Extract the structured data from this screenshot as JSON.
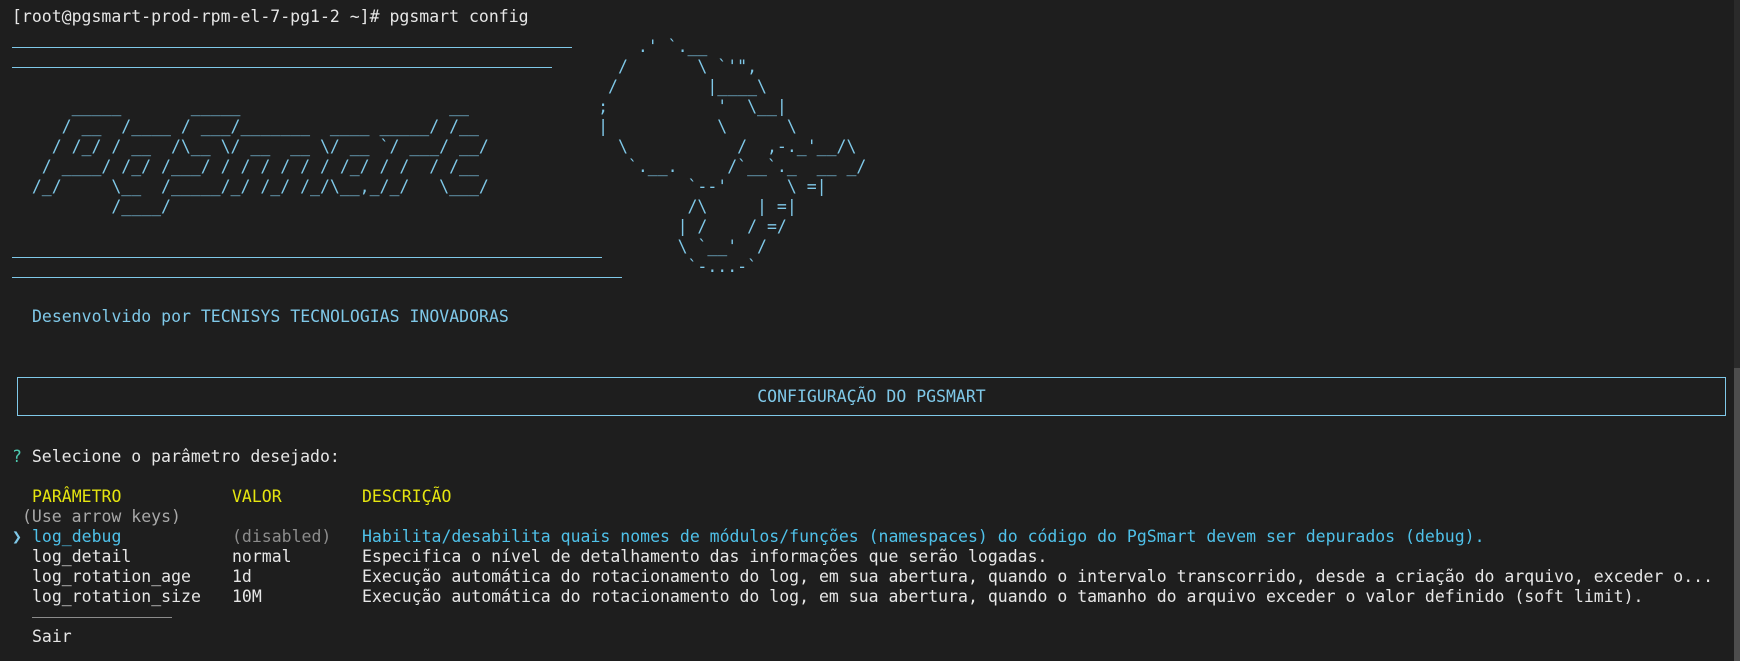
{
  "terminal": {
    "prompt_line": "[root@pgsmart-prod-rpm-el-7-pg1-2 ~]# pgsmart config",
    "banner_art": "                                                               .' `.__\n                                                             /       \\ `'\",\n                                                            /         |____\\\n      _____       _____                     __             ;           '  \\__|\n     / __  /____ / ___/_______  ____ _____/ /__            |           \\      \\\n    / /_/ / __  /\\__ \\/ __  __ \\/ __ `/ ___/ __/             \\           /  ,-._'__/\\\n   / ____/ /_/ /___/ / / / / / / /_/ / /  / /__               `.__.     /`__`._  __ _/\n  /_/     \\__  /_____/_/ /_/ /_/\\__,_/_/   \\___/                    `--'      \\ =|\n          /____/                                                    /\\     | =|\n                                                                   | /    / =/\n                                                                   \\ `__'  /\n                                                                    `-...-`",
    "developed_by": "Desenvolvido por TECNISYS TECNOLOGIAS INOVADORAS",
    "config_title": "CONFIGURAÇÃO DO PGSMART",
    "question_mark": "?",
    "question": "Selecione o parâmetro desejado:",
    "headers": {
      "param": "PARÂMETRO",
      "value": "VALOR",
      "desc": "DESCRIÇÃO"
    },
    "hint": "(Use arrow keys)",
    "cursor": "❯",
    "options": [
      {
        "param": "log_debug",
        "value": "(disabled)",
        "desc": "Habilita/desabilita quais nomes de módulos/funções (namespaces) do código do PgSmart devem ser depurados (debug)."
      },
      {
        "param": "log_detail",
        "value": "normal",
        "desc": "Especifica o nível de detalhamento das informações que serão logadas."
      },
      {
        "param": "log_rotation_age",
        "value": "1d",
        "desc": "Execução automática do rotacionamento do log, em sua abertura, quando o intervalo transcorrido, desde a criação do arquivo, exceder o..."
      },
      {
        "param": "log_rotation_size",
        "value": "10M",
        "desc": "Execução automática do rotacionamento do log, em sua abertura, quando o tamanho do arquivo exceder o valor definido (soft limit)."
      }
    ],
    "exit_label": "Sair"
  },
  "colors": {
    "background": "#1e1e1e",
    "ascii": "#7fc8e8",
    "header": "#e5e510",
    "selected": "#4fc1e9",
    "question_mark": "#4ec9b0"
  }
}
